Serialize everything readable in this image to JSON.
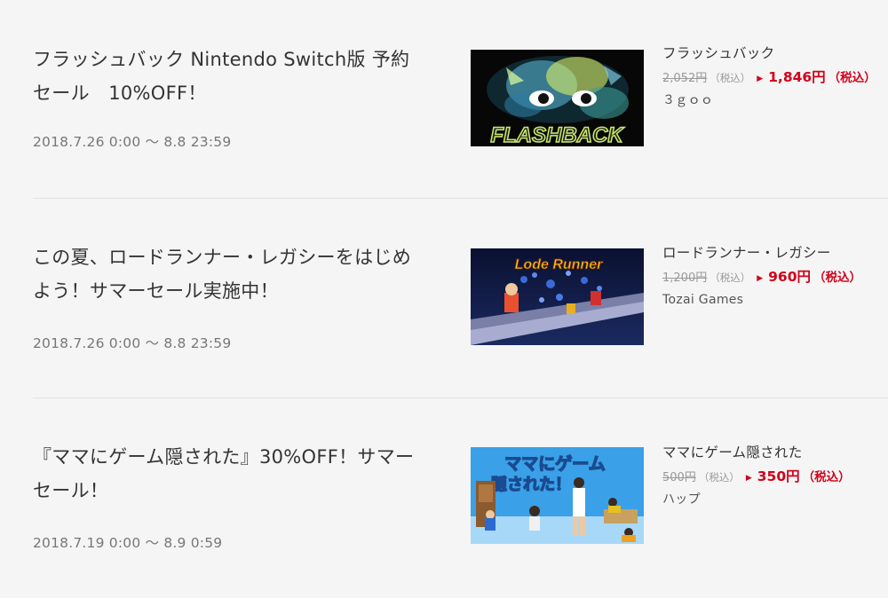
{
  "sales": [
    {
      "title": "フラッシュバック Nintendo Switch版 予約セール　10%OFF！",
      "period": "2018.7.26 0:00 〜 8.8 23:59",
      "game_name": "フラッシュバック",
      "original_price": "2,052円",
      "original_tax": "（税込）",
      "sale_price": "1,846円",
      "sale_tax": "（税込）",
      "maker": "３ｇｏｏ",
      "thumb_text": "FLASHBACK",
      "thumb_colors": {
        "bg": "#070707",
        "accent": "#7fd6f0",
        "glow": "#d8f06a"
      }
    },
    {
      "title": "この夏、ロードランナー・レガシーをはじめよう！サマーセール実施中！",
      "period": "2018.7.26 0:00 〜 8.8 23:59",
      "game_name": "ロードランナー・レガシー",
      "original_price": "1,200円",
      "original_tax": "（税込）",
      "sale_price": "960円",
      "sale_tax": "（税込）",
      "maker": "Tozai Games",
      "thumb_text": "Lode Runner",
      "thumb_colors": {
        "bg": "#0a1030",
        "accent": "#e8c020",
        "glow": "#4a70c8"
      }
    },
    {
      "title": "『ママにゲーム隠された』30%OFF！サマーセール！",
      "period": "2018.7.19 0:00 〜 8.9 0:59",
      "game_name": "ママにゲーム隠された",
      "original_price": "500円",
      "original_tax": "（税込）",
      "sale_price": "350円",
      "sale_tax": "（税込）",
      "maker": "ハップ",
      "thumb_text_line1": "ママにゲーム",
      "thumb_text_line2": "隠された！",
      "thumb_colors": {
        "bg": "#3aa0e8",
        "accent": "#ffffff",
        "glow": "#1a4a90"
      }
    }
  ],
  "colors": {
    "sale_red": "#d0021b",
    "background": "#f5f5f5",
    "divider": "#e2e2e2"
  }
}
